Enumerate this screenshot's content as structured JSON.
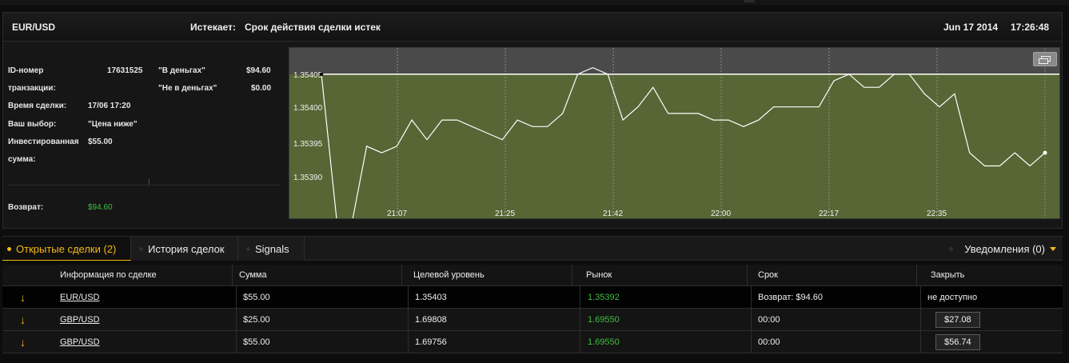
{
  "header": {
    "pair": "EUR/USD",
    "expires_label": "Истекает:",
    "expires_value": "Срок действия сделки истек",
    "date": "Jun 17 2014",
    "time": "17:26:48"
  },
  "trade_info": {
    "id_label_1": "ID-номер",
    "id_label_2": "транзакции:",
    "id_value": "17631525",
    "in_money_label": "\"В деньгах\"",
    "in_money_value": "$94.60",
    "out_money_label": "\"Не в деньгах\"",
    "out_money_value": "$0.00",
    "time_label": "Время сделки:",
    "time_value": "17/06 17:20",
    "choice_label": "Ваш выбор:",
    "choice_value": "\"Цена ниже\"",
    "invested_label_1": "Инвестированная",
    "invested_label_2": "сумма:",
    "invested_value": "$55.00",
    "return_label": "Возврат:",
    "return_value": "$94.60"
  },
  "chart_data": {
    "type": "line",
    "y_ticks": [
      "1.35405",
      "1.35400",
      "1.35395",
      "1.35390"
    ],
    "x_ticks": [
      "21:07",
      "21:25",
      "21:42",
      "22:00",
      "22:17",
      "22:35"
    ],
    "ylim": [
      1.35381,
      1.35407
    ],
    "target_level": 1.35403,
    "grid": true,
    "colors": {
      "above": "#4a4a4a",
      "below": "#566635",
      "line": "#ffffff"
    },
    "values": [
      1.35403,
      1.35381,
      1.3538,
      1.35392,
      1.35391,
      1.35392,
      1.35396,
      1.35393,
      1.35396,
      1.35396,
      1.35395,
      1.35394,
      1.35393,
      1.35396,
      1.35395,
      1.35395,
      1.35397,
      1.35403,
      1.35404,
      1.35403,
      1.35396,
      1.35398,
      1.35401,
      1.35397,
      1.35397,
      1.35397,
      1.35396,
      1.35396,
      1.35395,
      1.35396,
      1.35398,
      1.35398,
      1.35398,
      1.35398,
      1.35402,
      1.35403,
      1.35401,
      1.35401,
      1.35403,
      1.35403,
      1.354,
      1.35398,
      1.354,
      1.35391,
      1.35389,
      1.35389,
      1.35391,
      1.35389,
      1.35391
    ]
  },
  "tabs": {
    "open": "Открытые сделки (2)",
    "history": "История сделок",
    "signals": "Signals",
    "notifications": "Уведомления (0)"
  },
  "table": {
    "columns": [
      "Информация по сделке",
      "Сумма",
      "Целевой уровень",
      "Рынок",
      "Срок",
      "Закрыть"
    ],
    "rows": [
      {
        "direction": "↓",
        "pair": "EUR/USD",
        "amount": "$55.00",
        "target": "1.35403",
        "market": "1.35392",
        "term": "Возврат: $94.60",
        "close": "не доступно"
      },
      {
        "direction": "↓",
        "pair": "GBP/USD",
        "amount": "$25.00",
        "target": "1.69808",
        "market": "1.69550",
        "term": "00:00",
        "close": "$27.08"
      },
      {
        "direction": "↓",
        "pair": "GBP/USD",
        "amount": "$55.00",
        "target": "1.69756",
        "market": "1.69550",
        "term": "00:00",
        "close": "$56.74"
      }
    ]
  }
}
